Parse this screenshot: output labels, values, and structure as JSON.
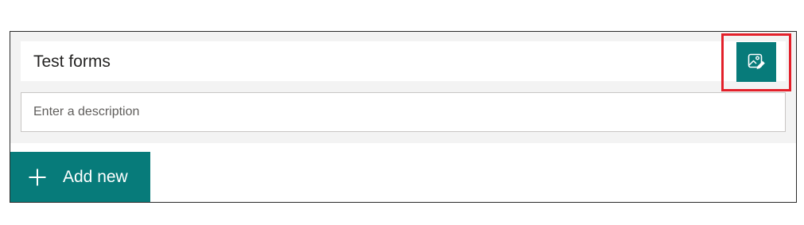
{
  "form": {
    "title": "Test forms",
    "description_placeholder": "Enter a description",
    "description_value": ""
  },
  "theme_button": {
    "icon": "image-edit-icon",
    "highlighted": true
  },
  "add_new": {
    "label": "Add new",
    "icon": "plus-icon"
  },
  "colors": {
    "accent": "#077b7a",
    "highlight": "#e3202a",
    "panel_background": "#f3f3f3"
  }
}
